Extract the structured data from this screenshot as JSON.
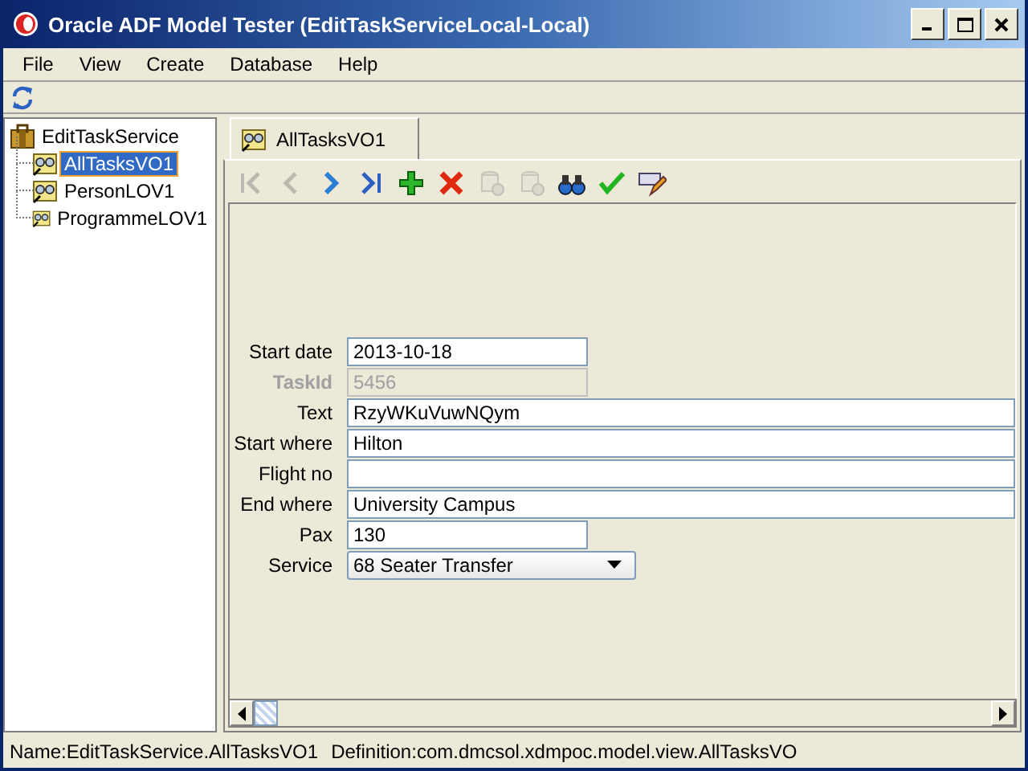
{
  "window": {
    "title": "Oracle ADF Model Tester (EditTaskServiceLocal-Local)"
  },
  "menu": [
    "File",
    "View",
    "Create",
    "Database",
    "Help"
  ],
  "tree": {
    "label": "EditTaskService",
    "expanded": true,
    "children": [
      {
        "label": "AllTasksVO1",
        "selected": true
      },
      {
        "label": "PersonLOV1",
        "selected": false
      },
      {
        "label": "ProgrammeLOV1",
        "selected": false
      }
    ]
  },
  "tabs": [
    {
      "label": "AllTasksVO1",
      "selected": true
    }
  ],
  "toolbar": [
    {
      "kind": "first",
      "disabled": true
    },
    {
      "kind": "previous",
      "disabled": true
    },
    {
      "kind": "next",
      "disabled": false
    },
    {
      "kind": "last",
      "disabled": false
    },
    {
      "kind": "add",
      "disabled": false
    },
    {
      "kind": "delete",
      "disabled": false
    },
    {
      "kind": "commit",
      "disabled": true
    },
    {
      "kind": "rollback",
      "disabled": true
    },
    {
      "kind": "find",
      "disabled": false
    },
    {
      "kind": "validate",
      "disabled": false
    },
    {
      "kind": "edit",
      "disabled": false
    }
  ],
  "form": [
    {
      "label": "Start date",
      "value": "2013-10-18",
      "kind": "short",
      "disabled": false
    },
    {
      "label": "TaskId",
      "value": "5456",
      "kind": "short",
      "disabled": true
    },
    {
      "label": "Text",
      "value": "RzyWKuVuwNQym",
      "kind": "long",
      "disabled": false
    },
    {
      "label": "Start where",
      "value": "Hilton",
      "kind": "long",
      "disabled": false
    },
    {
      "label": "Flight no",
      "kind": "long",
      "disabled": false
    },
    {
      "label": "End where",
      "value": "University Campus",
      "kind": "long",
      "disabled": false
    },
    {
      "label": "Pax",
      "value": "130",
      "kind": "short",
      "disabled": false
    },
    {
      "label": "Service",
      "value": "68 Seater Transfer",
      "kind": "dropdown"
    }
  ],
  "status_bar": {
    "name": "Name:EditTaskService.AllTasksVO1",
    "definition": "Definition:com.dmcsol.xdmpoc.model.view.AllTasksVO"
  }
}
